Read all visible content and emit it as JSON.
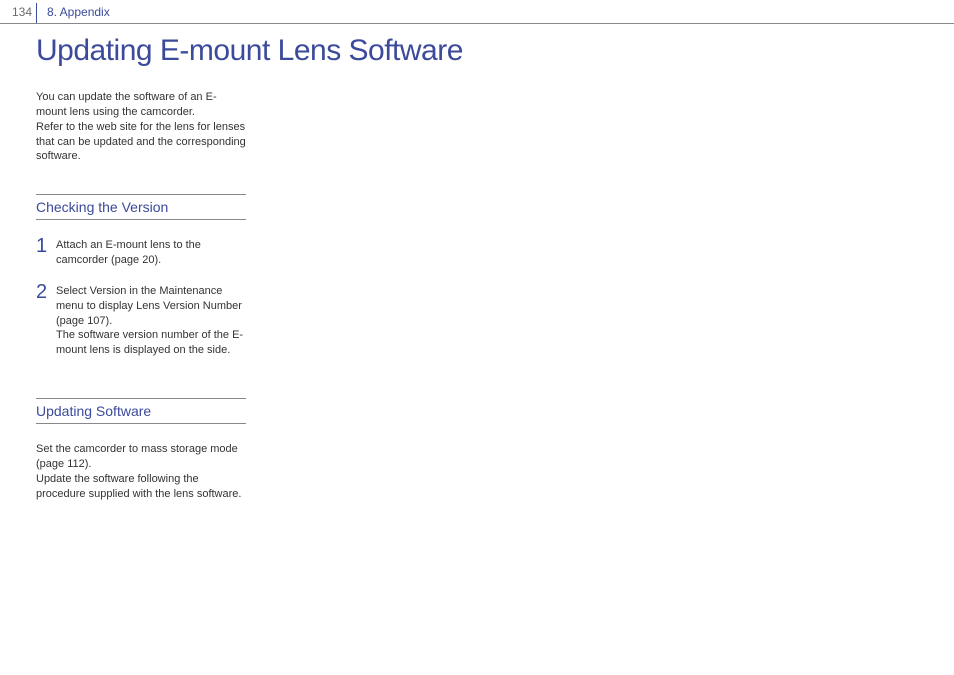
{
  "header": {
    "page_number": "134",
    "section": "8. Appendix"
  },
  "title": "Updating E-mount Lens Software",
  "intro": "You can update the software of an E-mount lens using the camcorder.\nRefer to the web site for the lens for lenses that can be updated and the corresponding software.",
  "section_checking": {
    "heading": "Checking the Version",
    "steps": [
      {
        "num": "1",
        "text": "Attach an E-mount lens to the camcorder (page 20)."
      },
      {
        "num": "2",
        "text": "Select Version in the Maintenance menu to display Lens Version Number (page 107).\nThe software version number of the E-mount lens is displayed on the side."
      }
    ]
  },
  "section_updating": {
    "heading": "Updating Software",
    "body": "Set the camcorder to mass storage mode (page 112).\nUpdate the software following the procedure supplied with the lens software."
  }
}
